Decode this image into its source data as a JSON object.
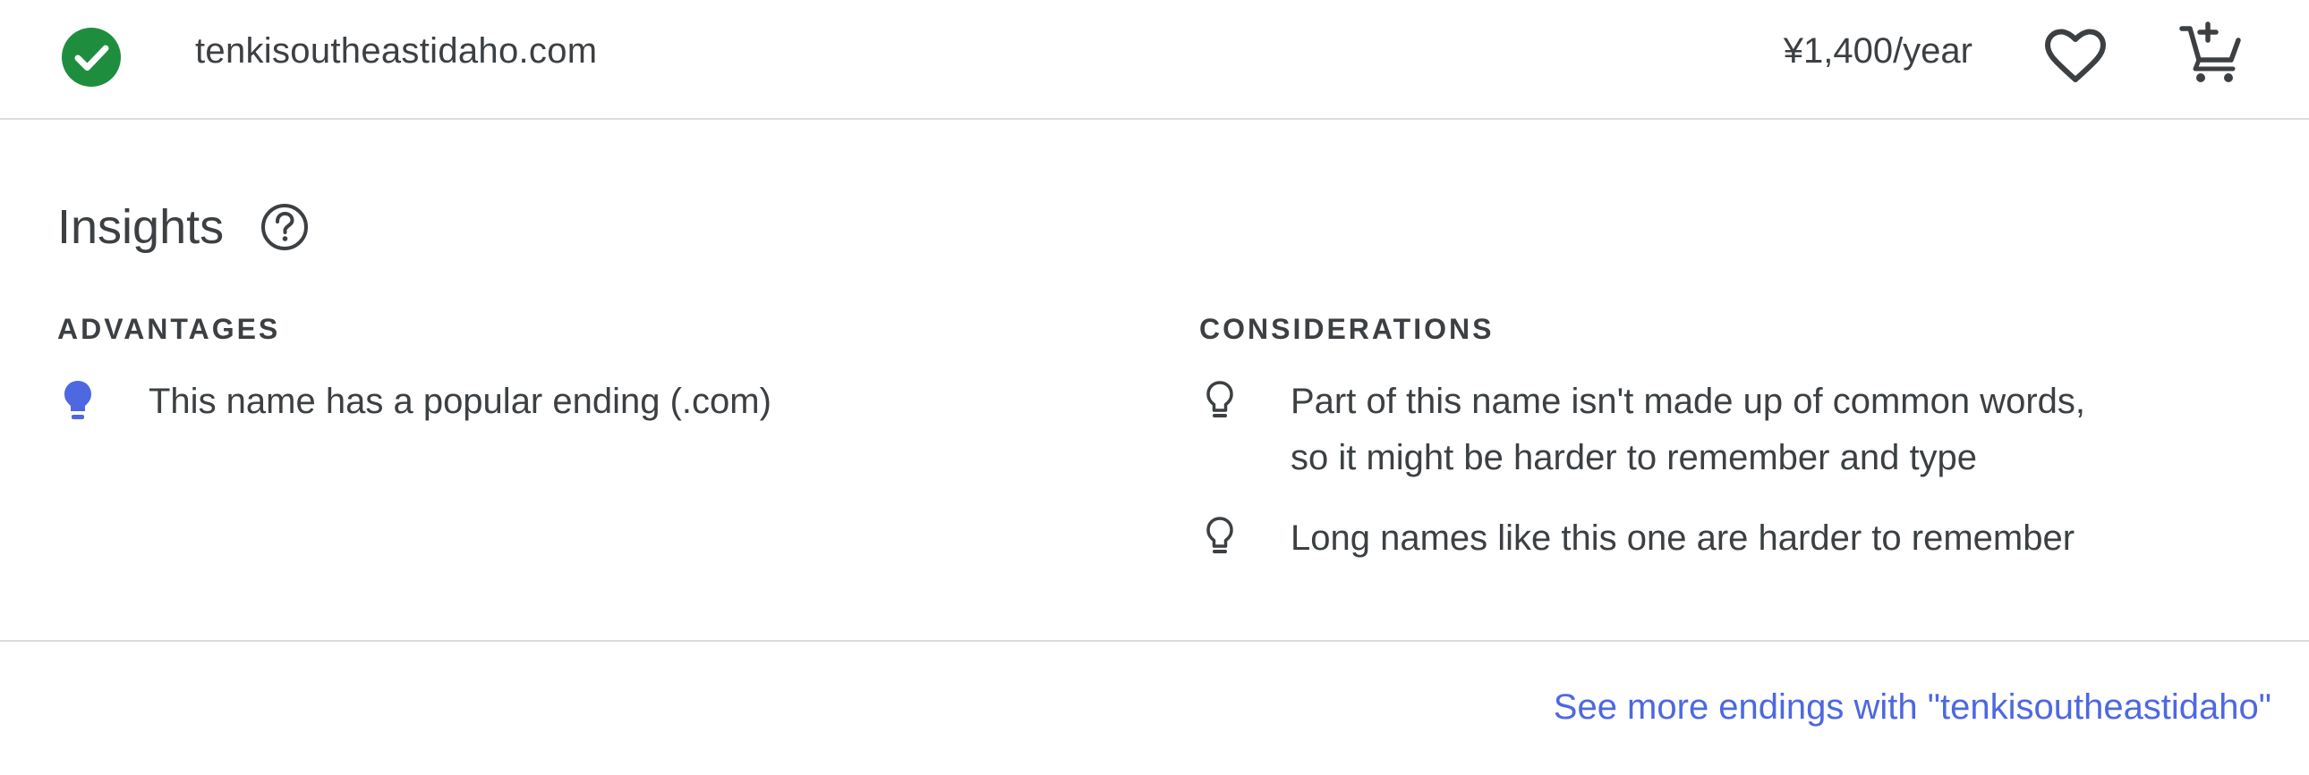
{
  "result": {
    "status_icon": "check-circle-icon",
    "domain_name": "tenkisoutheastidaho.com",
    "price": "¥1,400/year",
    "favorite_icon": "heart-outline-icon",
    "cart_icon": "add-shopping-cart-icon"
  },
  "insights": {
    "title": "Insights",
    "help_icon": "help-circle-icon",
    "advantages": {
      "heading": "ADVANTAGES",
      "items": [
        {
          "icon": "lightbulb-filled-icon",
          "text": "This name has a popular ending (.com)"
        }
      ]
    },
    "considerations": {
      "heading": "CONSIDERATIONS",
      "items": [
        {
          "icon": "lightbulb-outline-icon",
          "line1": "Part of this name isn't made up of common words,",
          "line2": "so it might be harder to remember and type"
        },
        {
          "icon": "lightbulb-outline-icon",
          "line1": "Long names like this one are harder to remember"
        }
      ]
    }
  },
  "footer": {
    "see_more_label": "See more endings with \"tenkisoutheastidaho\""
  },
  "colors": {
    "available_green": "#1e8e3e",
    "advantage_blue": "#4d68e0",
    "link_blue": "#4d68e0",
    "text": "#3c4043",
    "divider": "#dadce0"
  }
}
